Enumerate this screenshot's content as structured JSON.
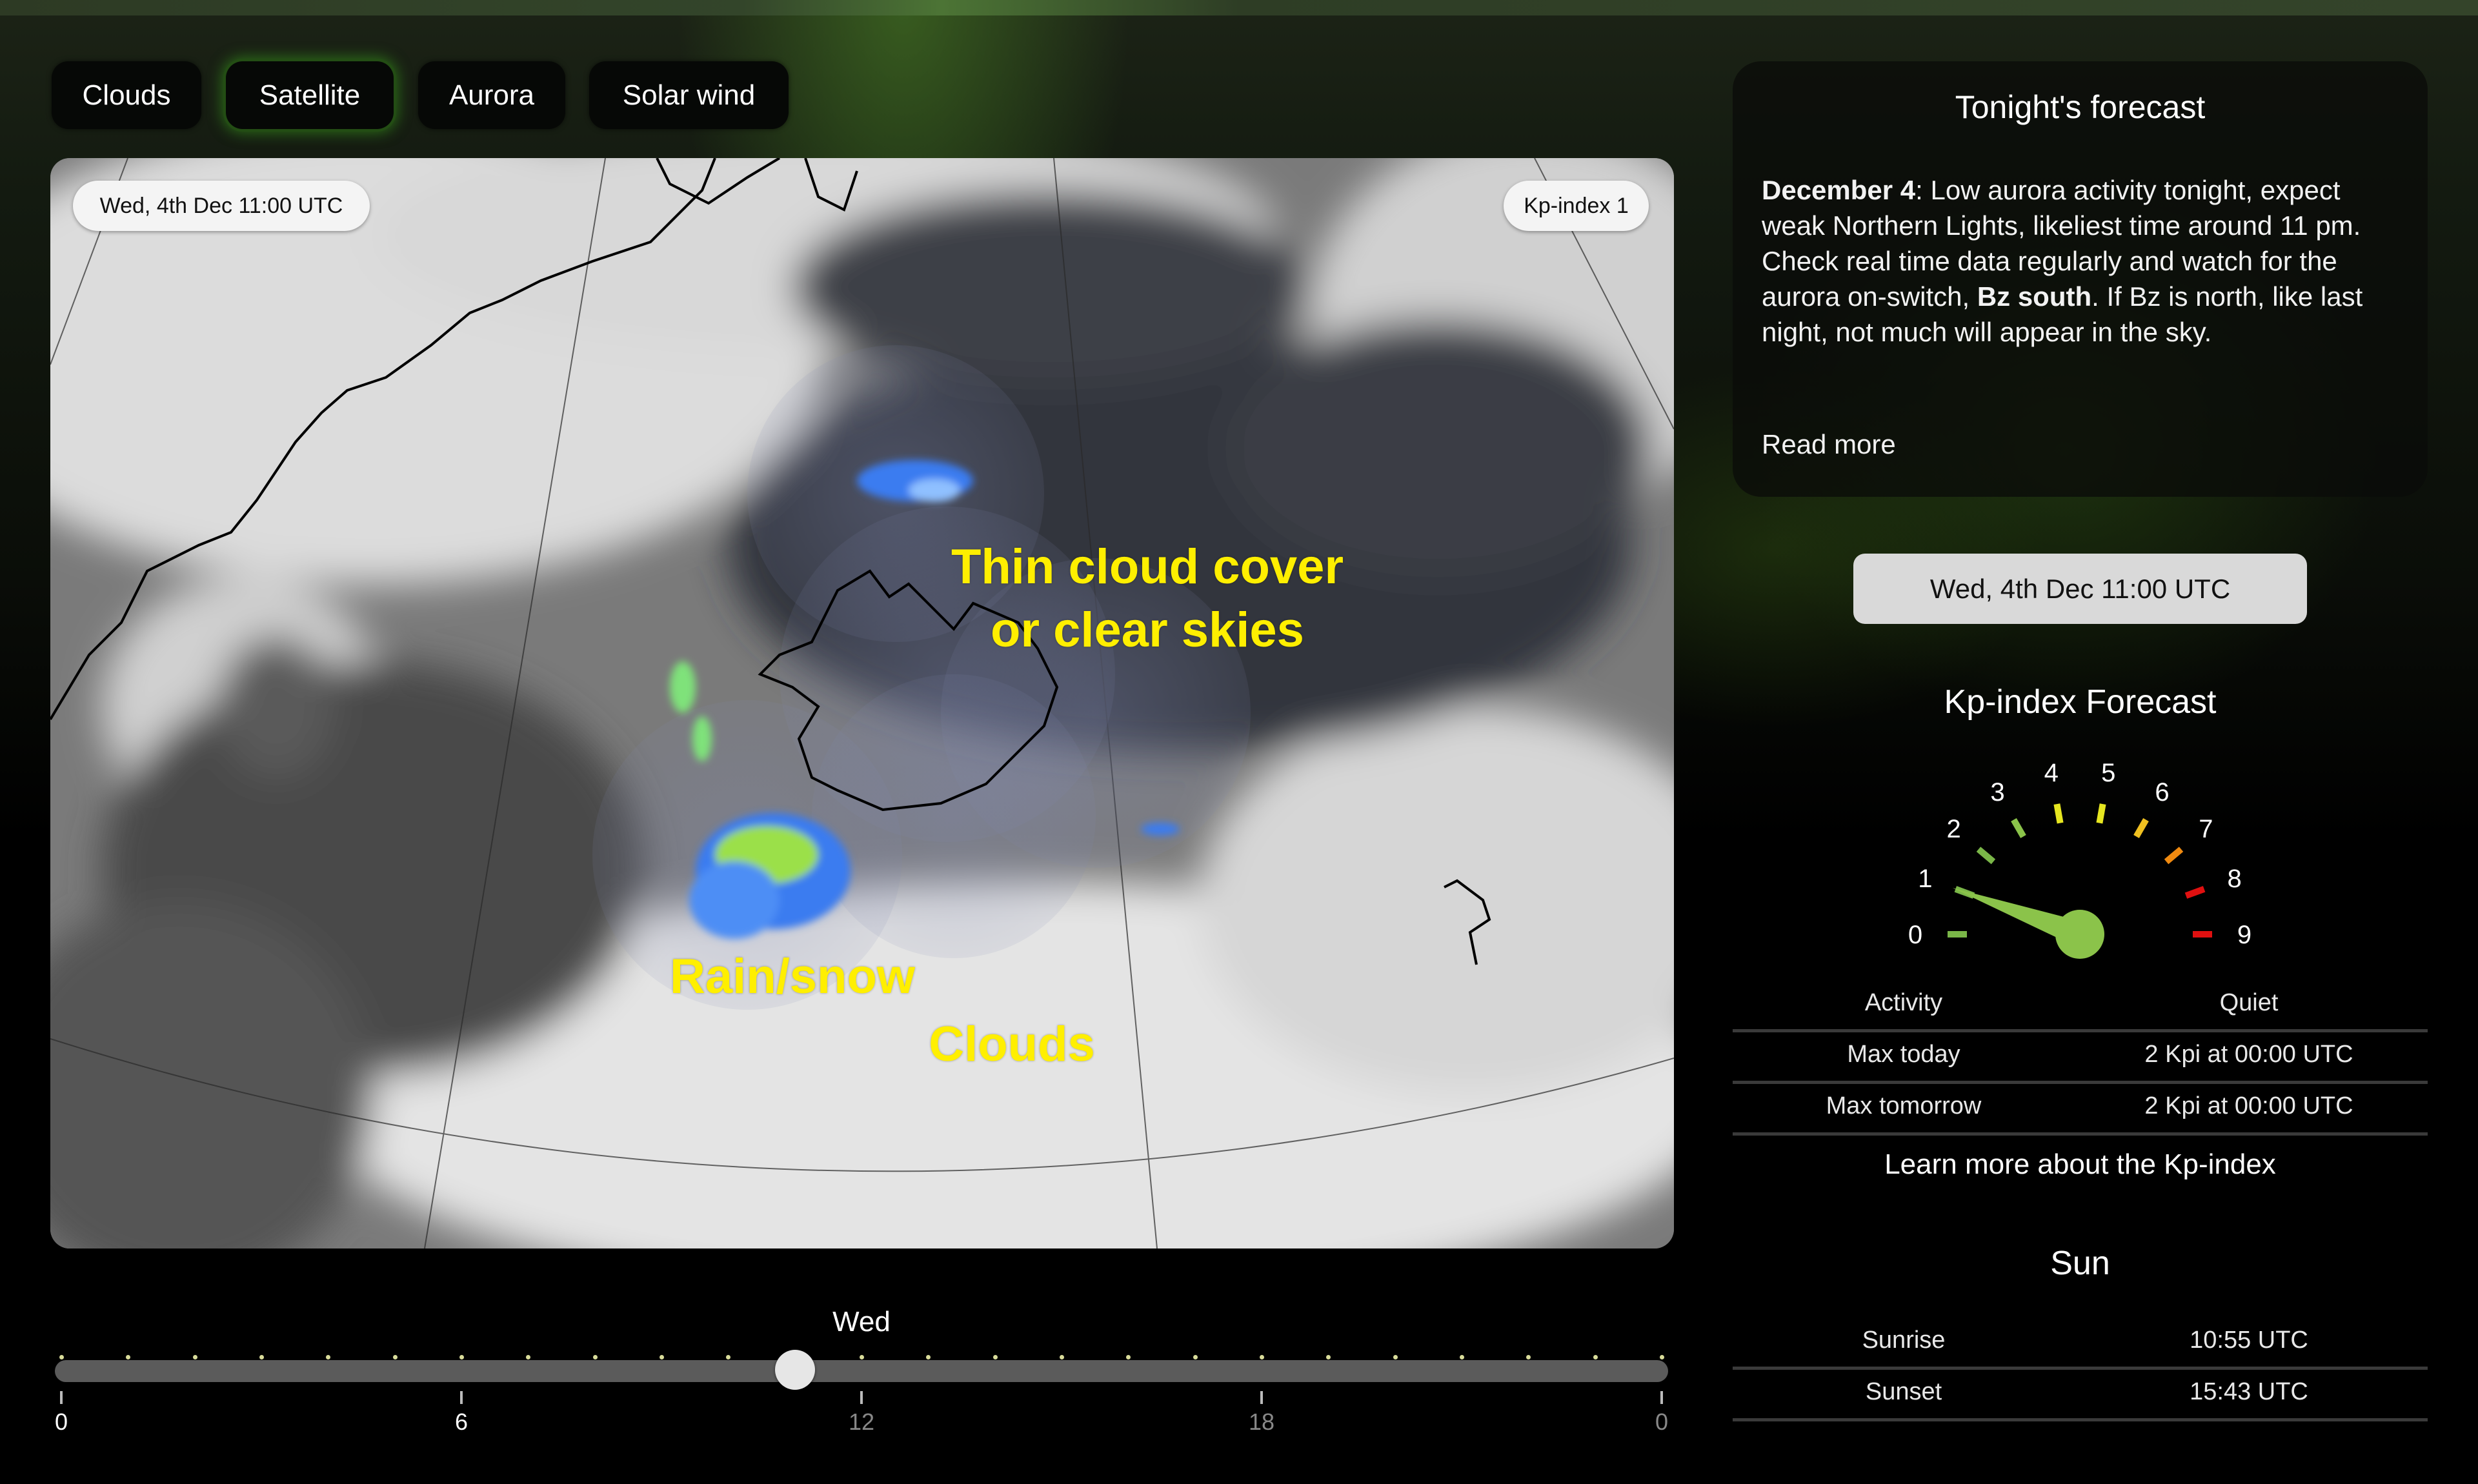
{
  "tabs": [
    {
      "label": "Clouds",
      "active": false
    },
    {
      "label": "Satellite",
      "active": true
    },
    {
      "label": "Aurora",
      "active": false
    },
    {
      "label": "Solar wind",
      "active": false
    }
  ],
  "map": {
    "timestamp_badge": "Wed, 4th Dec 11:00 UTC",
    "kp_badge": "Kp-index 1",
    "annotations": {
      "clear": [
        "Thin cloud cover",
        "or clear skies"
      ],
      "rain": "Rain/snow",
      "clouds": "Clouds"
    },
    "annotation_color": "#ffef00"
  },
  "forecast": {
    "title": "Tonight's forecast",
    "date_label": "December 4",
    "text_part1": ": Low aurora activity tonight, expect weak Northern Lights, likeliest time around 11 pm. Check real time data regularly and watch for the aurora on-switch, ",
    "text_bold": "Bz south",
    "text_part2": ". If Bz is north, like last night, not much will appear in the sky.",
    "read_more": "Read more"
  },
  "selected_time": "Wed, 4th Dec 11:00 UTC",
  "kp": {
    "title": "Kp-index Forecast",
    "value": 1,
    "min": 0,
    "max": 9,
    "scale_labels": [
      "0",
      "1",
      "2",
      "3",
      "4",
      "5",
      "6",
      "7",
      "8",
      "9"
    ],
    "scale_colors": [
      "#7ab648",
      "#7ab648",
      "#7ab648",
      "#8bc34a",
      "#e6e620",
      "#e6e620",
      "#f0c020",
      "#f08a10",
      "#e01010",
      "#e01010"
    ],
    "needle_color": "#8bc34a",
    "table": [
      {
        "label": "Activity",
        "value": "Quiet"
      },
      {
        "label": "Max today",
        "value": "2 Kpi at 00:00 UTC"
      },
      {
        "label": "Max tomorrow",
        "value": "2 Kpi at 00:00 UTC"
      }
    ],
    "learn_more": "Learn more about the Kp-index"
  },
  "sun": {
    "title": "Sun",
    "rows": [
      {
        "label": "Sunrise",
        "value": "10:55 UTC"
      },
      {
        "label": "Sunset",
        "value": "15:43 UTC"
      }
    ]
  },
  "timeline": {
    "day": "Wed",
    "current_hour": 11,
    "hours_total": 24,
    "tick_labels": [
      "0",
      "6",
      "12",
      "18",
      "0"
    ]
  }
}
